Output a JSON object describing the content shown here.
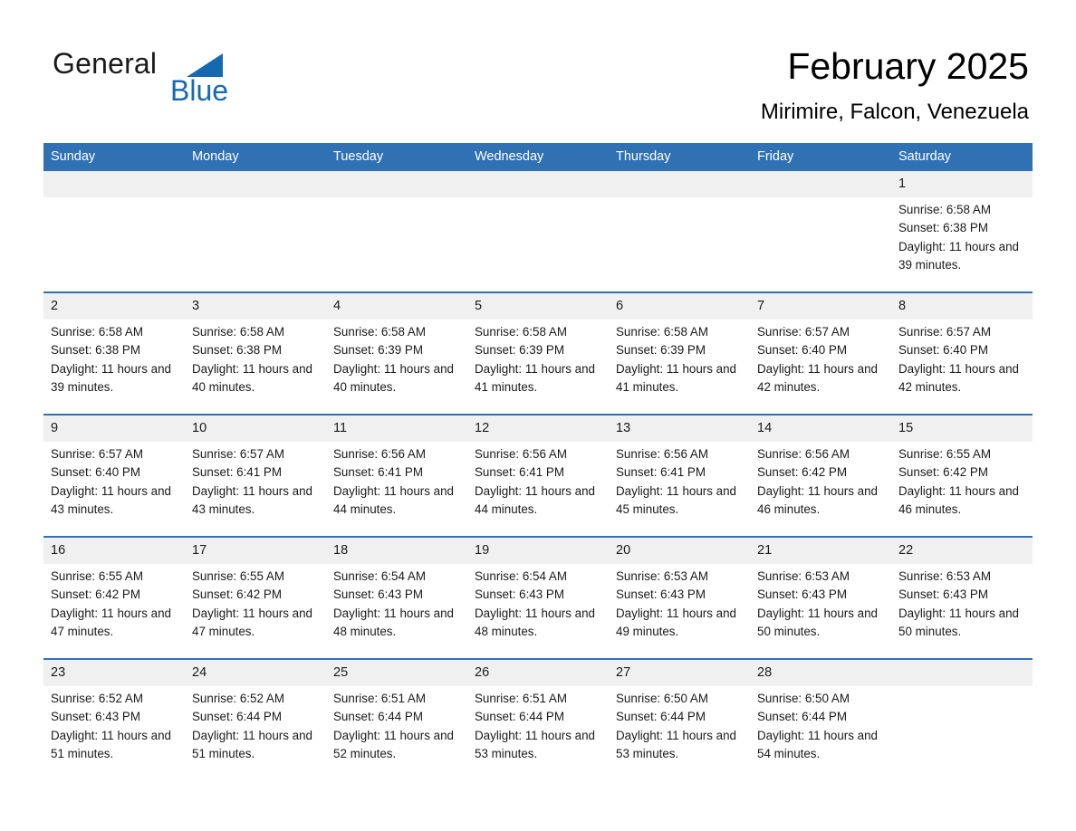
{
  "brand": {
    "name_part1": "General",
    "name_part2": "Blue",
    "triangle_color": "#1569b0"
  },
  "header": {
    "month_title": "February 2025",
    "location": "Mirimire, Falcon, Venezuela"
  },
  "theme": {
    "header_blue": "#3071b4",
    "band_gray": "#f0f0f0",
    "text": "#1a1a1a"
  },
  "weekday_headers": [
    "Sunday",
    "Monday",
    "Tuesday",
    "Wednesday",
    "Thursday",
    "Friday",
    "Saturday"
  ],
  "weeks": [
    [
      {
        "day": "",
        "sunrise": "",
        "sunset": "",
        "daylight": ""
      },
      {
        "day": "",
        "sunrise": "",
        "sunset": "",
        "daylight": ""
      },
      {
        "day": "",
        "sunrise": "",
        "sunset": "",
        "daylight": ""
      },
      {
        "day": "",
        "sunrise": "",
        "sunset": "",
        "daylight": ""
      },
      {
        "day": "",
        "sunrise": "",
        "sunset": "",
        "daylight": ""
      },
      {
        "day": "",
        "sunrise": "",
        "sunset": "",
        "daylight": ""
      },
      {
        "day": "1",
        "sunrise": "Sunrise: 6:58 AM",
        "sunset": "Sunset: 6:38 PM",
        "daylight": "Daylight: 11 hours and 39 minutes."
      }
    ],
    [
      {
        "day": "2",
        "sunrise": "Sunrise: 6:58 AM",
        "sunset": "Sunset: 6:38 PM",
        "daylight": "Daylight: 11 hours and 39 minutes."
      },
      {
        "day": "3",
        "sunrise": "Sunrise: 6:58 AM",
        "sunset": "Sunset: 6:38 PM",
        "daylight": "Daylight: 11 hours and 40 minutes."
      },
      {
        "day": "4",
        "sunrise": "Sunrise: 6:58 AM",
        "sunset": "Sunset: 6:39 PM",
        "daylight": "Daylight: 11 hours and 40 minutes."
      },
      {
        "day": "5",
        "sunrise": "Sunrise: 6:58 AM",
        "sunset": "Sunset: 6:39 PM",
        "daylight": "Daylight: 11 hours and 41 minutes."
      },
      {
        "day": "6",
        "sunrise": "Sunrise: 6:58 AM",
        "sunset": "Sunset: 6:39 PM",
        "daylight": "Daylight: 11 hours and 41 minutes."
      },
      {
        "day": "7",
        "sunrise": "Sunrise: 6:57 AM",
        "sunset": "Sunset: 6:40 PM",
        "daylight": "Daylight: 11 hours and 42 minutes."
      },
      {
        "day": "8",
        "sunrise": "Sunrise: 6:57 AM",
        "sunset": "Sunset: 6:40 PM",
        "daylight": "Daylight: 11 hours and 42 minutes."
      }
    ],
    [
      {
        "day": "9",
        "sunrise": "Sunrise: 6:57 AM",
        "sunset": "Sunset: 6:40 PM",
        "daylight": "Daylight: 11 hours and 43 minutes."
      },
      {
        "day": "10",
        "sunrise": "Sunrise: 6:57 AM",
        "sunset": "Sunset: 6:41 PM",
        "daylight": "Daylight: 11 hours and 43 minutes."
      },
      {
        "day": "11",
        "sunrise": "Sunrise: 6:56 AM",
        "sunset": "Sunset: 6:41 PM",
        "daylight": "Daylight: 11 hours and 44 minutes."
      },
      {
        "day": "12",
        "sunrise": "Sunrise: 6:56 AM",
        "sunset": "Sunset: 6:41 PM",
        "daylight": "Daylight: 11 hours and 44 minutes."
      },
      {
        "day": "13",
        "sunrise": "Sunrise: 6:56 AM",
        "sunset": "Sunset: 6:41 PM",
        "daylight": "Daylight: 11 hours and 45 minutes."
      },
      {
        "day": "14",
        "sunrise": "Sunrise: 6:56 AM",
        "sunset": "Sunset: 6:42 PM",
        "daylight": "Daylight: 11 hours and 46 minutes."
      },
      {
        "day": "15",
        "sunrise": "Sunrise: 6:55 AM",
        "sunset": "Sunset: 6:42 PM",
        "daylight": "Daylight: 11 hours and 46 minutes."
      }
    ],
    [
      {
        "day": "16",
        "sunrise": "Sunrise: 6:55 AM",
        "sunset": "Sunset: 6:42 PM",
        "daylight": "Daylight: 11 hours and 47 minutes."
      },
      {
        "day": "17",
        "sunrise": "Sunrise: 6:55 AM",
        "sunset": "Sunset: 6:42 PM",
        "daylight": "Daylight: 11 hours and 47 minutes."
      },
      {
        "day": "18",
        "sunrise": "Sunrise: 6:54 AM",
        "sunset": "Sunset: 6:43 PM",
        "daylight": "Daylight: 11 hours and 48 minutes."
      },
      {
        "day": "19",
        "sunrise": "Sunrise: 6:54 AM",
        "sunset": "Sunset: 6:43 PM",
        "daylight": "Daylight: 11 hours and 48 minutes."
      },
      {
        "day": "20",
        "sunrise": "Sunrise: 6:53 AM",
        "sunset": "Sunset: 6:43 PM",
        "daylight": "Daylight: 11 hours and 49 minutes."
      },
      {
        "day": "21",
        "sunrise": "Sunrise: 6:53 AM",
        "sunset": "Sunset: 6:43 PM",
        "daylight": "Daylight: 11 hours and 50 minutes."
      },
      {
        "day": "22",
        "sunrise": "Sunrise: 6:53 AM",
        "sunset": "Sunset: 6:43 PM",
        "daylight": "Daylight: 11 hours and 50 minutes."
      }
    ],
    [
      {
        "day": "23",
        "sunrise": "Sunrise: 6:52 AM",
        "sunset": "Sunset: 6:43 PM",
        "daylight": "Daylight: 11 hours and 51 minutes."
      },
      {
        "day": "24",
        "sunrise": "Sunrise: 6:52 AM",
        "sunset": "Sunset: 6:44 PM",
        "daylight": "Daylight: 11 hours and 51 minutes."
      },
      {
        "day": "25",
        "sunrise": "Sunrise: 6:51 AM",
        "sunset": "Sunset: 6:44 PM",
        "daylight": "Daylight: 11 hours and 52 minutes."
      },
      {
        "day": "26",
        "sunrise": "Sunrise: 6:51 AM",
        "sunset": "Sunset: 6:44 PM",
        "daylight": "Daylight: 11 hours and 53 minutes."
      },
      {
        "day": "27",
        "sunrise": "Sunrise: 6:50 AM",
        "sunset": "Sunset: 6:44 PM",
        "daylight": "Daylight: 11 hours and 53 minutes."
      },
      {
        "day": "28",
        "sunrise": "Sunrise: 6:50 AM",
        "sunset": "Sunset: 6:44 PM",
        "daylight": "Daylight: 11 hours and 54 minutes."
      },
      {
        "day": "",
        "sunrise": "",
        "sunset": "",
        "daylight": ""
      }
    ]
  ]
}
